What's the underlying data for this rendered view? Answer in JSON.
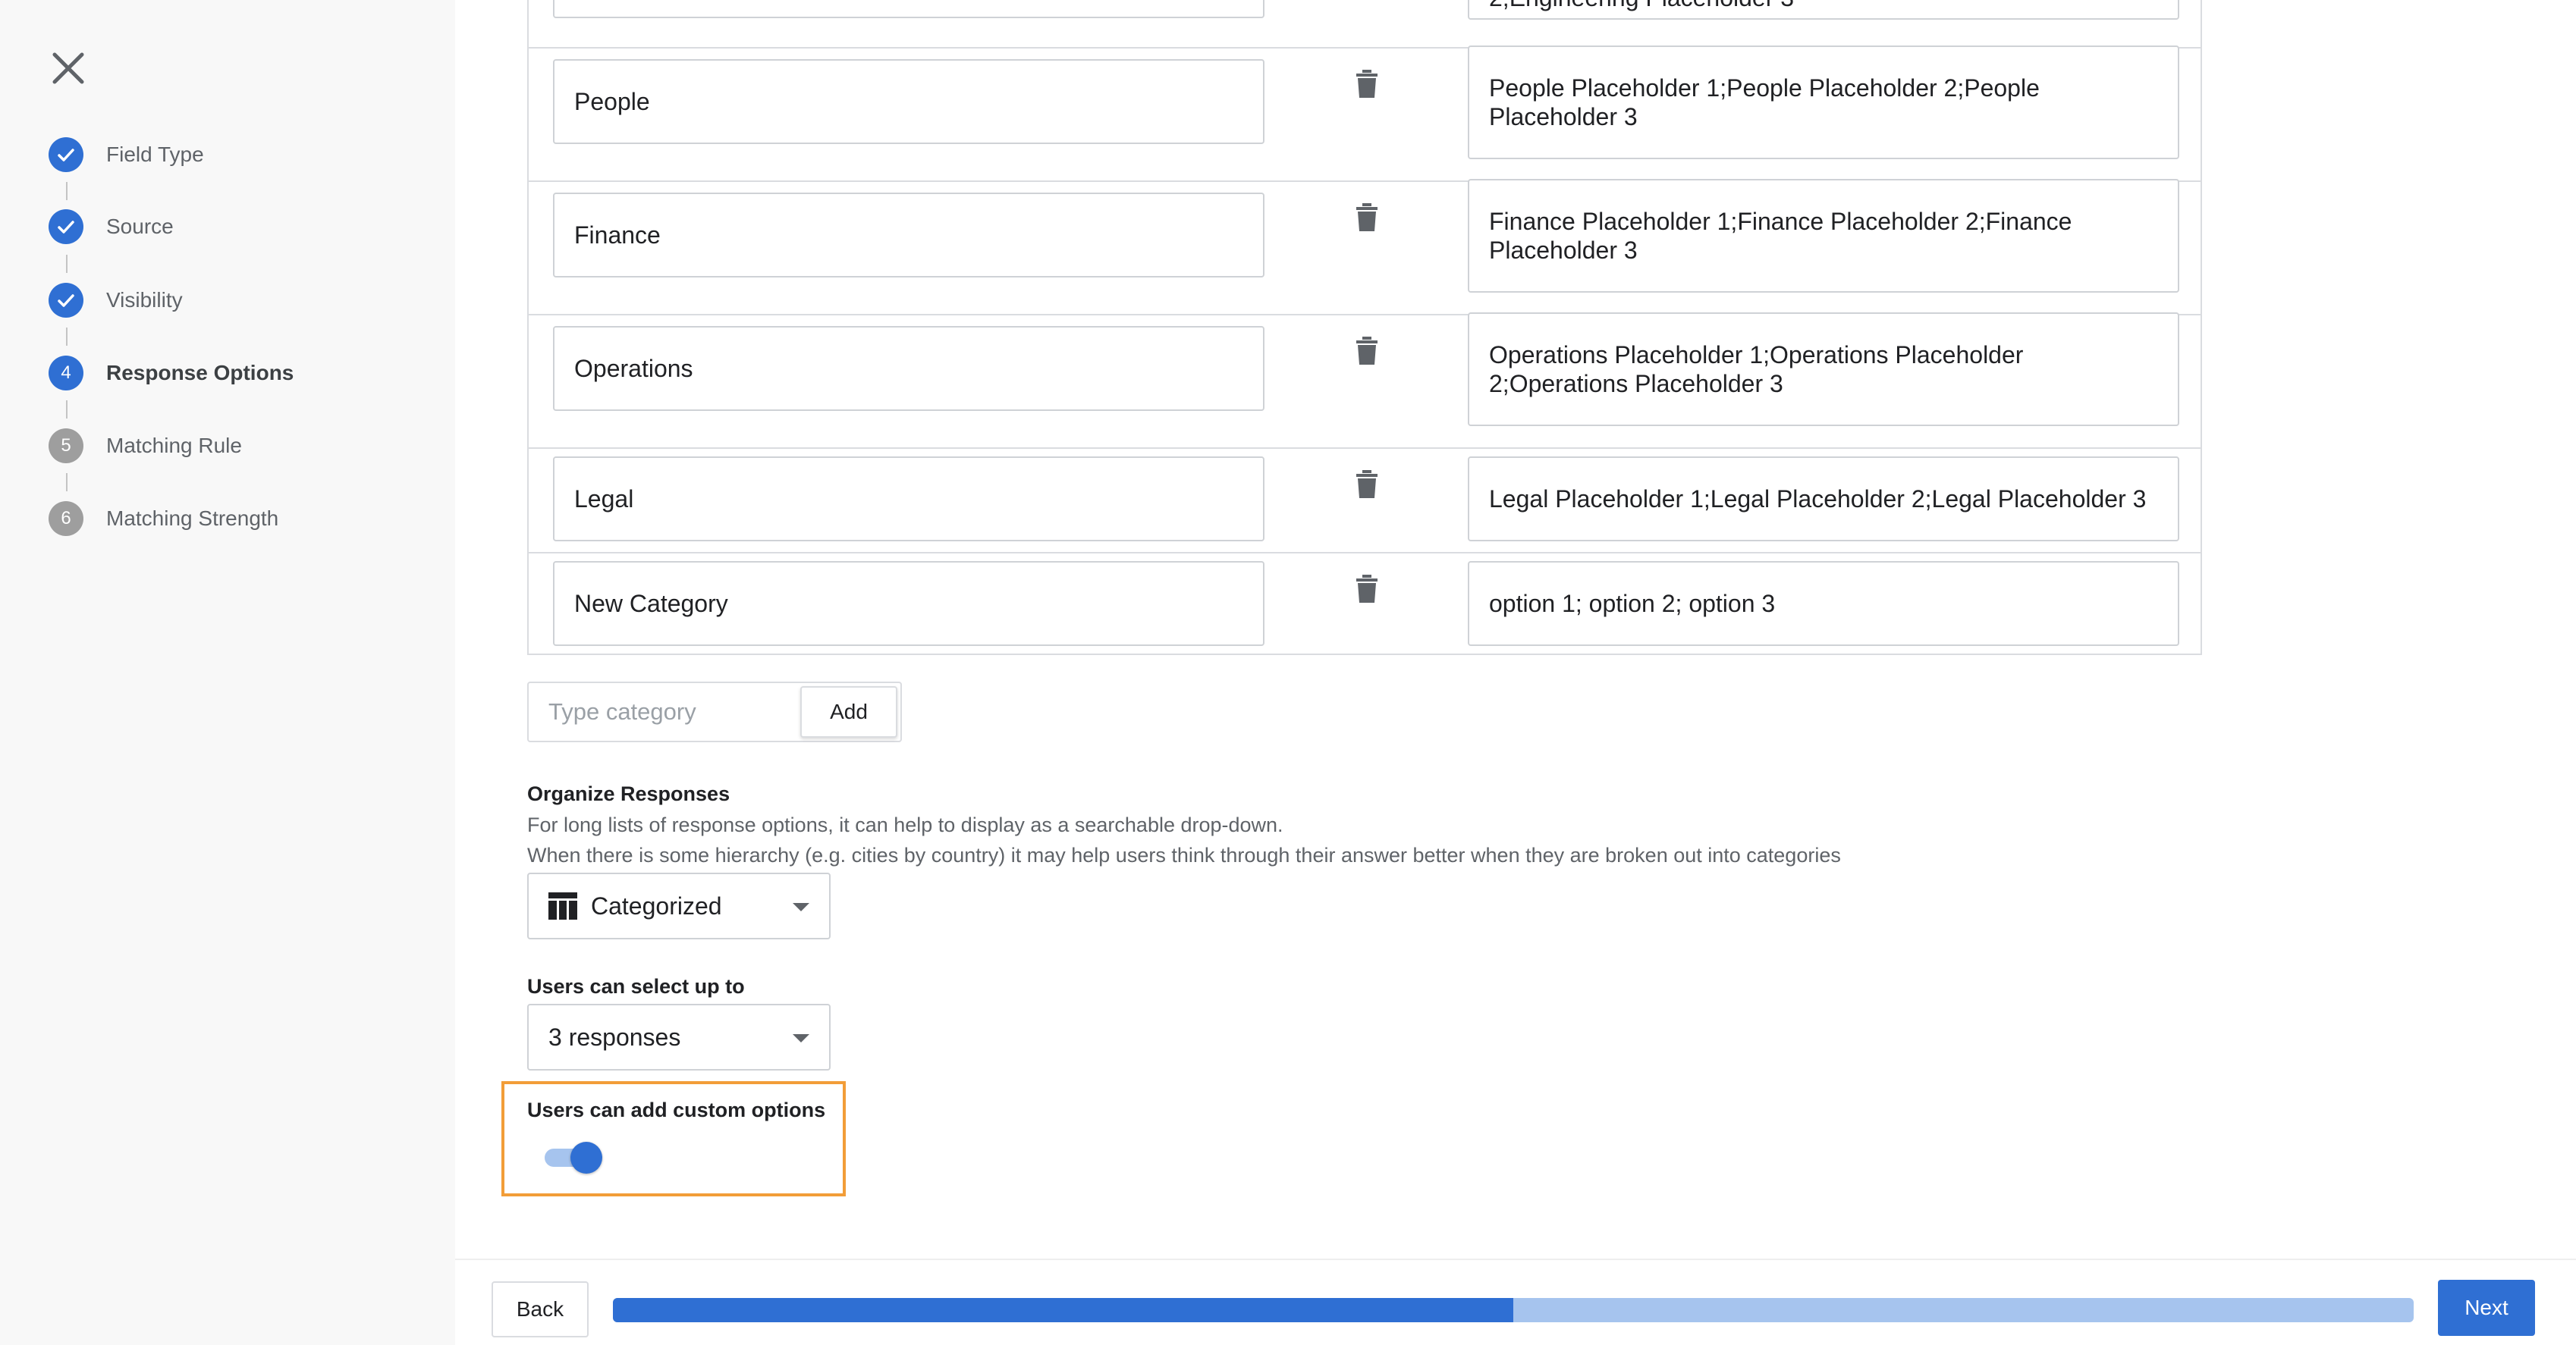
{
  "steps": [
    {
      "label": "Field Type",
      "status": "done",
      "number": ""
    },
    {
      "label": "Source",
      "status": "done",
      "number": ""
    },
    {
      "label": "Visibility",
      "status": "done",
      "number": ""
    },
    {
      "label": "Response Options",
      "status": "active",
      "number": "4"
    },
    {
      "label": "Matching Rule",
      "status": "pending",
      "number": "5"
    },
    {
      "label": "Matching Strength",
      "status": "pending",
      "number": "6"
    }
  ],
  "categories": [
    {
      "name": "",
      "options": "2;Engineering Placeholder 3"
    },
    {
      "name": "People",
      "options": "People Placeholder 1;People Placeholder 2;People Placeholder 3"
    },
    {
      "name": "Finance",
      "options": "Finance Placeholder 1;Finance Placeholder 2;Finance Placeholder 3"
    },
    {
      "name": "Operations",
      "options": "Operations Placeholder 1;Operations Placeholder 2;Operations Placeholder 3"
    },
    {
      "name": "Legal",
      "options": "Legal Placeholder 1;Legal Placeholder 2;Legal Placeholder 3"
    },
    {
      "name": "New Category",
      "options": "option 1; option 2; option 3"
    }
  ],
  "add_category": {
    "placeholder": "Type category",
    "button_label": "Add"
  },
  "organize": {
    "title": "Organize Responses",
    "desc_line1": "For long lists of response options, it can help to display as a searchable drop-down.",
    "desc_line2": "When there is some hierarchy (e.g. cities by country) it may help users think through their answer better when they are broken out into categories",
    "selected": "Categorized",
    "icon": "table-icon"
  },
  "select_limit": {
    "title": "Users can select up to",
    "selected": "3 responses"
  },
  "custom_options": {
    "title": "Users can add custom options",
    "enabled": true
  },
  "footer": {
    "back_label": "Back",
    "next_label": "Next",
    "progress": 0.5
  }
}
